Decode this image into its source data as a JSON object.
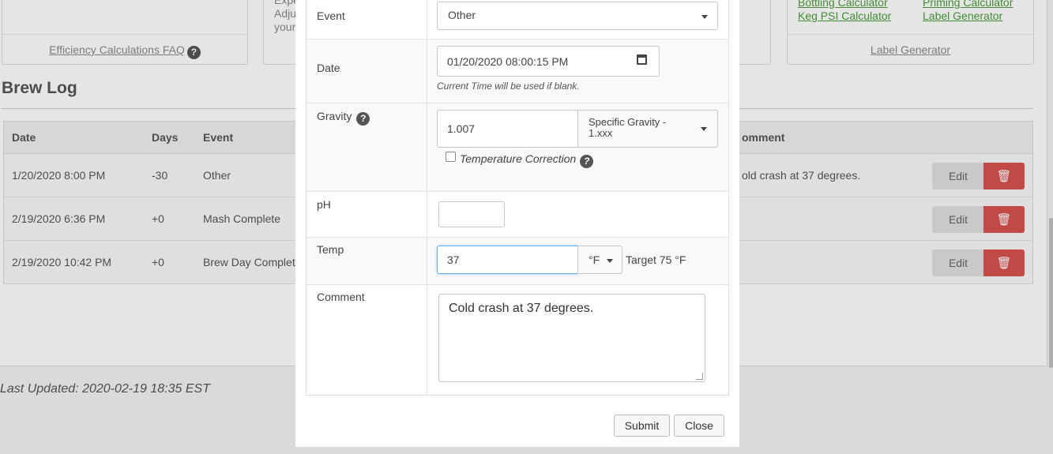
{
  "cards": {
    "efficiency_faq_link": "Efficiency Calculations FAQ",
    "card2_lines": [
      "Expe",
      "Adju",
      "your"
    ],
    "tools": {
      "bottling": "Bottling Calculator",
      "priming": "Priming Calculator",
      "keg_psi": "Keg PSI Calculator",
      "label_gen": "Label Generator",
      "label_gen_footer": "Label Generator"
    }
  },
  "brew_log": {
    "title": "Brew Log",
    "headers": {
      "date": "Date",
      "days": "Days",
      "event": "Event",
      "comment": "omment"
    },
    "rows": [
      {
        "date": "1/20/2020 8:00 PM",
        "days": "-30",
        "event": "Other",
        "comment": "old crash at 37 degrees."
      },
      {
        "date": "2/19/2020 6:36 PM",
        "days": "+0",
        "event": "Mash Complete",
        "comment": ""
      },
      {
        "date": "2/19/2020 10:42 PM",
        "days": "+0",
        "event": "Brew Day Complet",
        "comment": ""
      }
    ],
    "edit_label": "Edit"
  },
  "last_updated": "Last Updated: 2020-02-19 18:35 EST",
  "modal": {
    "event": {
      "label": "Event",
      "value": "Other"
    },
    "date": {
      "label": "Date",
      "value": "01/20/2020 08:00:15 PM",
      "hint": "Current Time will be used if blank."
    },
    "gravity": {
      "label": "Gravity",
      "value": "1.007",
      "unit_line1": "Specific Gravity -",
      "unit_line2": "1.xxx",
      "temp_correction_label": "Temperature Correction",
      "temp_correction_checked": false
    },
    "ph": {
      "label": "pH",
      "value": ""
    },
    "temp": {
      "label": "Temp",
      "value": "37",
      "unit": "°F",
      "target": "Target 75 °F"
    },
    "comment": {
      "label": "Comment",
      "value": "Cold crash at 37 degrees."
    },
    "submit_label": "Submit",
    "close_label": "Close"
  }
}
